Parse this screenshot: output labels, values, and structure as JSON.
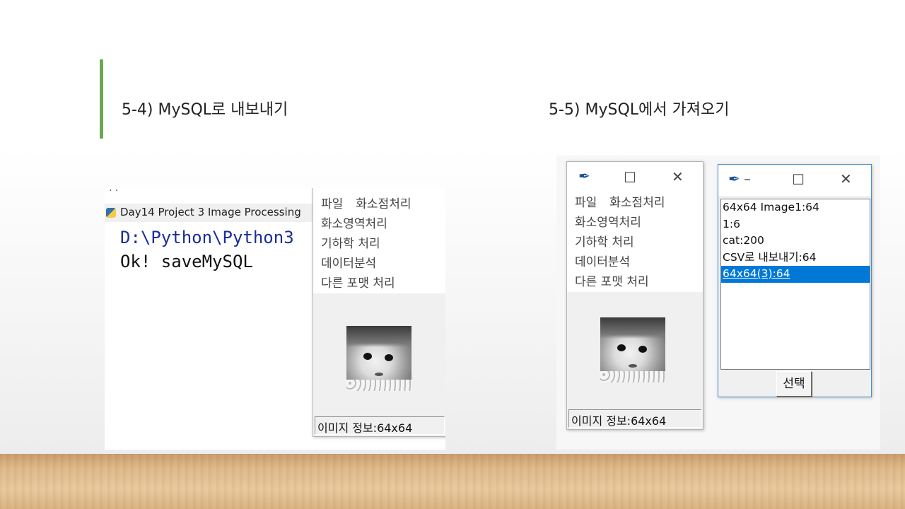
{
  "slide": {
    "left_title": "5-4) MySQL로 내보내기",
    "right_title": "5-5) MySQL에서 가져오기",
    "accent_color": "#6aa84f"
  },
  "left_screenshot": {
    "console_tab_label": "Day14 Project 3 Image Processing",
    "console_dots": ". .",
    "console_lines": [
      "D:\\Python\\Python3",
      "Ok! saveMySQL"
    ],
    "app_menu": [
      "파일",
      "화소점처리",
      "화소영역처리",
      "기하학 처리",
      "데이터분석",
      "다른 포맷 처리"
    ],
    "status_text": "이미지 정보:64x64"
  },
  "right_screenshot": {
    "app_titlebar_icons": [
      "feather-icon",
      "maximize-icon",
      "close-icon"
    ],
    "app_menu": [
      "파일",
      "화소점처리",
      "화소영역처리",
      "기하학 처리",
      "데이터분석",
      "다른 포맷 처리"
    ],
    "status_text": "이미지 정보:64x64",
    "dialog": {
      "titlebar_icons": [
        "feather-icon",
        "minimize-icon",
        "maximize-icon",
        "close-icon"
      ],
      "list_items": [
        "64x64 Image1:64",
        "1:6",
        "cat:200",
        "CSV로 내보내기:64",
        "64x64(3):64"
      ],
      "selected_item": "64x64(3):64",
      "selection_color": "#0078d7",
      "select_button_label": "선택"
    }
  }
}
